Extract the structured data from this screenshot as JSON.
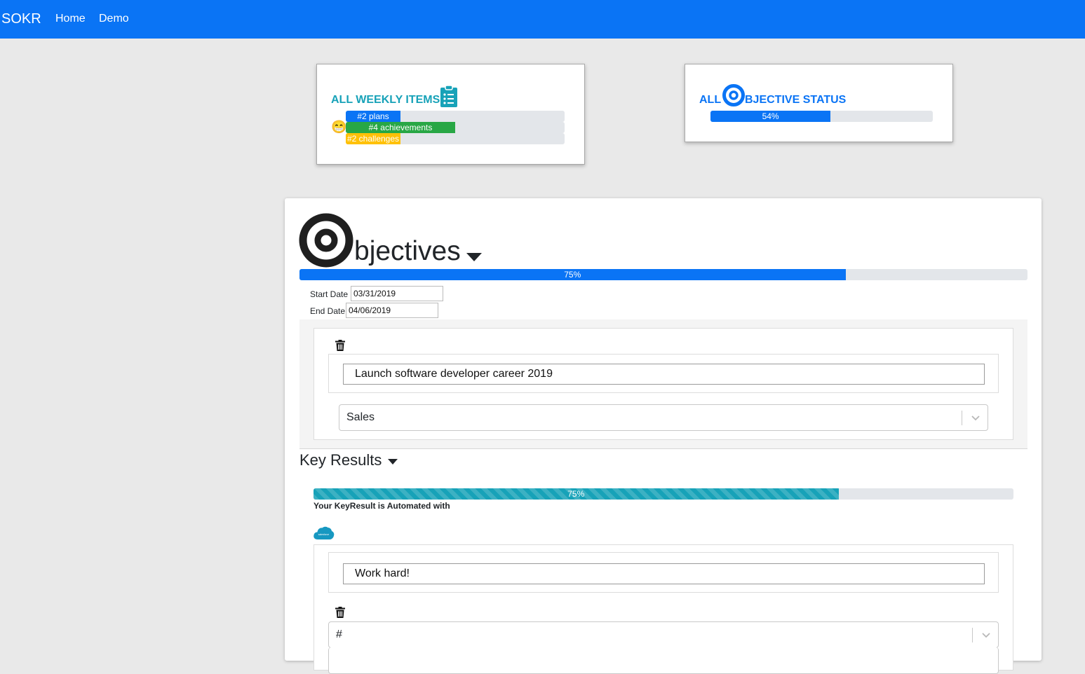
{
  "nav": {
    "brand": "SOKR",
    "links": [
      "Home",
      "Demo"
    ]
  },
  "weekly": {
    "title": "ALL WEEKLY ITEMS",
    "mood_emoji": "😁",
    "bars": [
      {
        "label": "#2 plans",
        "percent": 25,
        "color": "#0a74f5"
      },
      {
        "label": "#4 achievements",
        "percent": 50,
        "color": "#28a745"
      },
      {
        "label": "#2 challenges",
        "percent": 25,
        "color": "#ffc107"
      }
    ]
  },
  "objective_status": {
    "title_prefix": "ALL",
    "title_suffix": "BJECTIVE STATUS",
    "percent_label": "54%",
    "percent": 54
  },
  "objectives": {
    "heading": "bjectives",
    "progress_label": "75%",
    "progress": 75,
    "start_label": "Start Date",
    "start_value": "03/31/2019",
    "end_label": "End Date",
    "end_value": "04/06/2019",
    "objective_text": "Launch software developer career 2019",
    "category": "Sales"
  },
  "key_results": {
    "heading": "Key Results",
    "progress_label": "75%",
    "progress": 75,
    "automated_text": "Your KeyResult is Automated with",
    "logo_text": "salesforce",
    "kr_text": "Work hard!",
    "metric_select": "#"
  },
  "colors": {
    "primary": "#0a74f5",
    "teal": "#17a2b8",
    "success": "#28a745",
    "warning": "#ffc107"
  }
}
